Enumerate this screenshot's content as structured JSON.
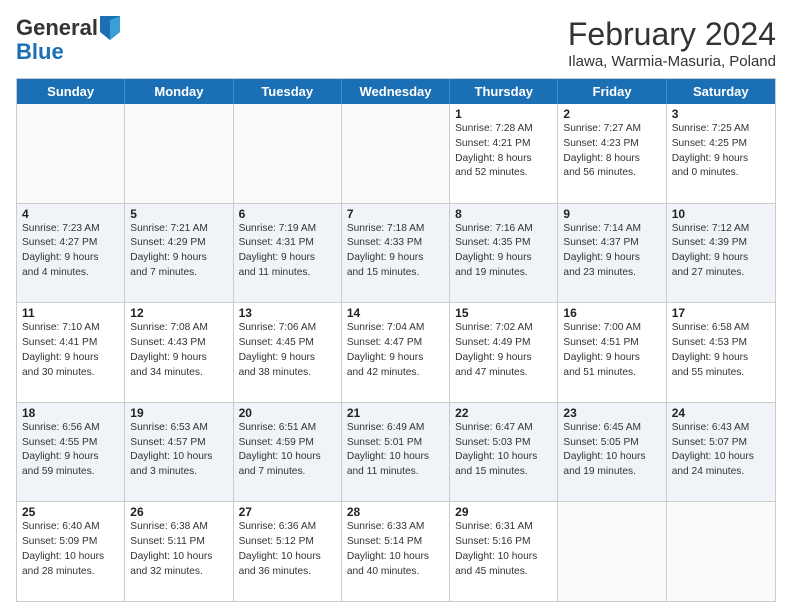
{
  "logo": {
    "line1": "General",
    "line2": "Blue"
  },
  "title": "February 2024",
  "subtitle": "Ilawa, Warmia-Masuria, Poland",
  "header_days": [
    "Sunday",
    "Monday",
    "Tuesday",
    "Wednesday",
    "Thursday",
    "Friday",
    "Saturday"
  ],
  "weeks": [
    [
      {
        "day": "",
        "info": ""
      },
      {
        "day": "",
        "info": ""
      },
      {
        "day": "",
        "info": ""
      },
      {
        "day": "",
        "info": ""
      },
      {
        "day": "1",
        "info": "Sunrise: 7:28 AM\nSunset: 4:21 PM\nDaylight: 8 hours\nand 52 minutes."
      },
      {
        "day": "2",
        "info": "Sunrise: 7:27 AM\nSunset: 4:23 PM\nDaylight: 8 hours\nand 56 minutes."
      },
      {
        "day": "3",
        "info": "Sunrise: 7:25 AM\nSunset: 4:25 PM\nDaylight: 9 hours\nand 0 minutes."
      }
    ],
    [
      {
        "day": "4",
        "info": "Sunrise: 7:23 AM\nSunset: 4:27 PM\nDaylight: 9 hours\nand 4 minutes."
      },
      {
        "day": "5",
        "info": "Sunrise: 7:21 AM\nSunset: 4:29 PM\nDaylight: 9 hours\nand 7 minutes."
      },
      {
        "day": "6",
        "info": "Sunrise: 7:19 AM\nSunset: 4:31 PM\nDaylight: 9 hours\nand 11 minutes."
      },
      {
        "day": "7",
        "info": "Sunrise: 7:18 AM\nSunset: 4:33 PM\nDaylight: 9 hours\nand 15 minutes."
      },
      {
        "day": "8",
        "info": "Sunrise: 7:16 AM\nSunset: 4:35 PM\nDaylight: 9 hours\nand 19 minutes."
      },
      {
        "day": "9",
        "info": "Sunrise: 7:14 AM\nSunset: 4:37 PM\nDaylight: 9 hours\nand 23 minutes."
      },
      {
        "day": "10",
        "info": "Sunrise: 7:12 AM\nSunset: 4:39 PM\nDaylight: 9 hours\nand 27 minutes."
      }
    ],
    [
      {
        "day": "11",
        "info": "Sunrise: 7:10 AM\nSunset: 4:41 PM\nDaylight: 9 hours\nand 30 minutes."
      },
      {
        "day": "12",
        "info": "Sunrise: 7:08 AM\nSunset: 4:43 PM\nDaylight: 9 hours\nand 34 minutes."
      },
      {
        "day": "13",
        "info": "Sunrise: 7:06 AM\nSunset: 4:45 PM\nDaylight: 9 hours\nand 38 minutes."
      },
      {
        "day": "14",
        "info": "Sunrise: 7:04 AM\nSunset: 4:47 PM\nDaylight: 9 hours\nand 42 minutes."
      },
      {
        "day": "15",
        "info": "Sunrise: 7:02 AM\nSunset: 4:49 PM\nDaylight: 9 hours\nand 47 minutes."
      },
      {
        "day": "16",
        "info": "Sunrise: 7:00 AM\nSunset: 4:51 PM\nDaylight: 9 hours\nand 51 minutes."
      },
      {
        "day": "17",
        "info": "Sunrise: 6:58 AM\nSunset: 4:53 PM\nDaylight: 9 hours\nand 55 minutes."
      }
    ],
    [
      {
        "day": "18",
        "info": "Sunrise: 6:56 AM\nSunset: 4:55 PM\nDaylight: 9 hours\nand 59 minutes."
      },
      {
        "day": "19",
        "info": "Sunrise: 6:53 AM\nSunset: 4:57 PM\nDaylight: 10 hours\nand 3 minutes."
      },
      {
        "day": "20",
        "info": "Sunrise: 6:51 AM\nSunset: 4:59 PM\nDaylight: 10 hours\nand 7 minutes."
      },
      {
        "day": "21",
        "info": "Sunrise: 6:49 AM\nSunset: 5:01 PM\nDaylight: 10 hours\nand 11 minutes."
      },
      {
        "day": "22",
        "info": "Sunrise: 6:47 AM\nSunset: 5:03 PM\nDaylight: 10 hours\nand 15 minutes."
      },
      {
        "day": "23",
        "info": "Sunrise: 6:45 AM\nSunset: 5:05 PM\nDaylight: 10 hours\nand 19 minutes."
      },
      {
        "day": "24",
        "info": "Sunrise: 6:43 AM\nSunset: 5:07 PM\nDaylight: 10 hours\nand 24 minutes."
      }
    ],
    [
      {
        "day": "25",
        "info": "Sunrise: 6:40 AM\nSunset: 5:09 PM\nDaylight: 10 hours\nand 28 minutes."
      },
      {
        "day": "26",
        "info": "Sunrise: 6:38 AM\nSunset: 5:11 PM\nDaylight: 10 hours\nand 32 minutes."
      },
      {
        "day": "27",
        "info": "Sunrise: 6:36 AM\nSunset: 5:12 PM\nDaylight: 10 hours\nand 36 minutes."
      },
      {
        "day": "28",
        "info": "Sunrise: 6:33 AM\nSunset: 5:14 PM\nDaylight: 10 hours\nand 40 minutes."
      },
      {
        "day": "29",
        "info": "Sunrise: 6:31 AM\nSunset: 5:16 PM\nDaylight: 10 hours\nand 45 minutes."
      },
      {
        "day": "",
        "info": ""
      },
      {
        "day": "",
        "info": ""
      }
    ]
  ]
}
